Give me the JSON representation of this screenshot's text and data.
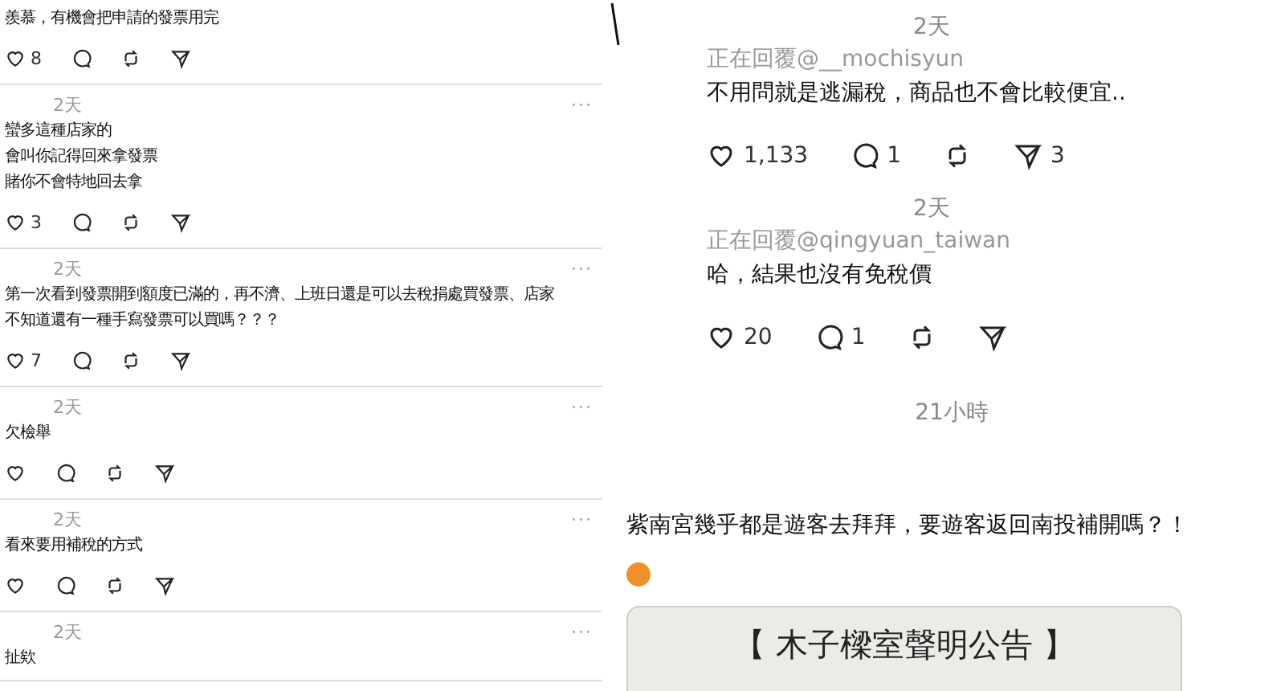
{
  "left_posts": [
    {
      "lines": [
        "羨慕，有機會把申請的發票用完"
      ],
      "likes": "8"
    },
    {
      "time": "2天",
      "lines": [
        "蠻多這種店家的",
        "會叫你記得回來拿發票",
        "賭你不會特地回去拿"
      ],
      "likes": "3",
      "more": "···"
    },
    {
      "time": "2天",
      "lines": [
        "第一次看到發票開到額度已滿的，再不濟、上班日還是可以去稅捐處買發票、店家",
        "不知道還有一種手寫發票可以買嗎？？？"
      ],
      "likes": "7",
      "more": "···"
    },
    {
      "time": "2天",
      "lines": [
        "欠檢舉"
      ],
      "more": "···"
    },
    {
      "time": "2天",
      "lines": [
        "看來要用補稅的方式"
      ],
      "more": "···"
    },
    {
      "time": "2天",
      "lines": [
        "扯欸"
      ],
      "more": "···"
    }
  ],
  "right_posts": [
    {
      "kind": "reply",
      "time": "2天",
      "replying_to": "正在回覆@__mochisyun",
      "text": "不用問就是逃漏稅，商品也不會比較便宜..",
      "likes": "1,133",
      "replies": "1",
      "shares": "3"
    },
    {
      "kind": "reply",
      "time": "2天",
      "replying_to": "正在回覆@qingyuan_taiwan",
      "text": "哈，結果也沒有免稅價",
      "likes": "20",
      "replies": "1"
    },
    {
      "kind": "post",
      "time": "21小時",
      "text": "紫南宮幾乎都是遊客去拜拜，要遊客返回南投補開嗎？！",
      "card_title": "【 木子樑室聲明公告 】"
    }
  ]
}
